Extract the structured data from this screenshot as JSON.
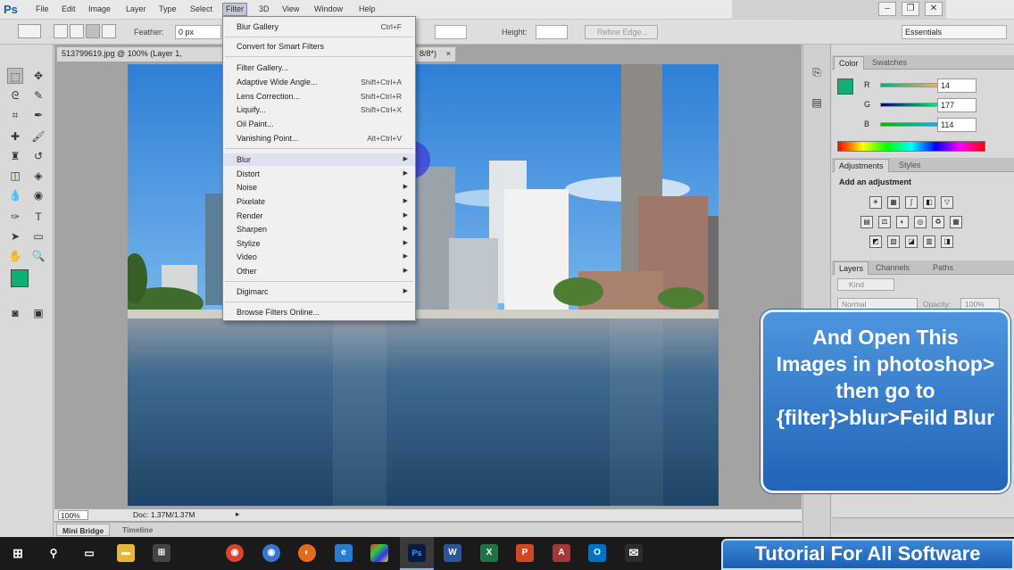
{
  "app": {
    "logo": "Ps"
  },
  "menubar": {
    "items": [
      "File",
      "Edit",
      "Image",
      "Layer",
      "Type",
      "Select",
      "Filter",
      "3D",
      "View",
      "Window",
      "Help"
    ],
    "active": "Filter"
  },
  "options": {
    "feather_label": "Feather:",
    "feather_value": "0 px",
    "height_label": "Height:",
    "refine_edge": "Refine Edge...",
    "workspace": "Essentials"
  },
  "document": {
    "tab_title": "513799619.jpg @ 100% (Layer 1,",
    "tab_suffix": "8/8*)",
    "zoom": "100%",
    "doc_size": "Doc: 1.37M/1.37M"
  },
  "bottom_tabs": [
    "Mini Bridge",
    "Timeline"
  ],
  "filter_menu": {
    "items": [
      {
        "label": "Blur Gallery",
        "shortcut": "Ctrl+F"
      },
      {
        "label": "Convert for Smart Filters",
        "shortcut": ""
      },
      {
        "label": "Filter Gallery...",
        "shortcut": ""
      },
      {
        "label": "Adaptive Wide Angle...",
        "shortcut": "Shift+Ctrl+A"
      },
      {
        "label": "Lens Correction...",
        "shortcut": "Shift+Ctrl+R"
      },
      {
        "label": "Liquify...",
        "shortcut": "Shift+Ctrl+X"
      },
      {
        "label": "Oil Paint...",
        "shortcut": ""
      },
      {
        "label": "Vanishing Point...",
        "shortcut": "Alt+Ctrl+V"
      },
      {
        "label": "Blur",
        "shortcut": ""
      },
      {
        "label": "Distort",
        "shortcut": ""
      },
      {
        "label": "Noise",
        "shortcut": ""
      },
      {
        "label": "Pixelate",
        "shortcut": ""
      },
      {
        "label": "Render",
        "shortcut": ""
      },
      {
        "label": "Sharpen",
        "shortcut": ""
      },
      {
        "label": "Stylize",
        "shortcut": ""
      },
      {
        "label": "Video",
        "shortcut": ""
      },
      {
        "label": "Other",
        "shortcut": ""
      },
      {
        "label": "Digimarc",
        "shortcut": ""
      },
      {
        "label": "Browse Filters Online...",
        "shortcut": ""
      }
    ]
  },
  "color_panel": {
    "tabs": [
      "Color",
      "Swatches"
    ],
    "r_label": "R",
    "r_value": "14",
    "g_label": "G",
    "g_value": "177",
    "b_label": "B",
    "b_value": "114",
    "foreground": "#0eb172"
  },
  "adjustments_panel": {
    "tabs": [
      "Adjustments",
      "Styles"
    ],
    "heading": "Add an adjustment"
  },
  "layers_panel": {
    "tabs": [
      "Layers",
      "Channels",
      "Paths"
    ],
    "kind": "Kind",
    "blend_mode": "Normal",
    "opacity_label": "Opacity:",
    "opacity_value": "100%"
  },
  "callout": {
    "text": "And Open This Images in photoshop> then go to {filter}>blur>Feild Blur"
  },
  "banner": {
    "text": "Tutorial For All Software"
  },
  "taskbar": {
    "apps": [
      "Start",
      "Search",
      "Task View",
      "File Explorer",
      "Store",
      "Chrome",
      "Chrome Canary",
      "Firefox",
      "Edge",
      "Apps",
      "Photoshop",
      "Word",
      "Excel",
      "PowerPoint",
      "Access",
      "Outlook",
      "Mail"
    ]
  }
}
